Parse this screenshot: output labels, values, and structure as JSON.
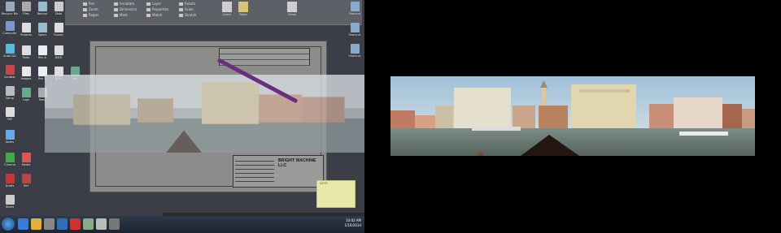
{
  "ribbon": {
    "groups": [
      [
        "Pan",
        "Zoom",
        "Regen"
      ],
      [
        "Annotate",
        "Dimension",
        "Mark"
      ],
      [
        "Layer",
        "Properties",
        "Match"
      ],
      [
        "Rotate",
        "Scale",
        "Stretch"
      ]
    ],
    "large_buttons": [
      "Insert",
      "Paste",
      "Views"
    ]
  },
  "desktop_icons": {
    "col1": [
      "Recycle Bin",
      "Computer",
      "AutoCAD",
      "Acrobat",
      "Setup",
      "PDF",
      "Notes",
      "Chrome",
      "Drafts",
      "Excel",
      "IE",
      "Tools",
      "Sheet"
    ],
    "col2": [
      "Files",
      "Projects",
      "Parts",
      "Images",
      "Logs",
      "Media",
      "Ref",
      "Docs",
      "IE"
    ],
    "col3": [
      "Backup",
      "Specs",
      "Rev A",
      "Rev B",
      "Temp",
      "Data",
      "Export"
    ],
    "extra_top": [
      "DWG",
      "BOM",
      "Fab"
    ],
    "right_top": [
      "Shortcut",
      "Shortcut",
      "Shortcut"
    ]
  },
  "sheet": {
    "company": "BRIGHT MACHINE LLC",
    "rev_rows": [
      "",
      "",
      ""
    ]
  },
  "sticky": {
    "lines": [
      "NOTE",
      "",
      ""
    ]
  },
  "taskbar": {
    "time": "10:03 AM",
    "date": "1/16/2014"
  },
  "colors": {
    "desktop": "#3b3e46",
    "taskbar": "#1c2430",
    "accent": "#6a2e80",
    "sticky": "#e9e8a8"
  }
}
